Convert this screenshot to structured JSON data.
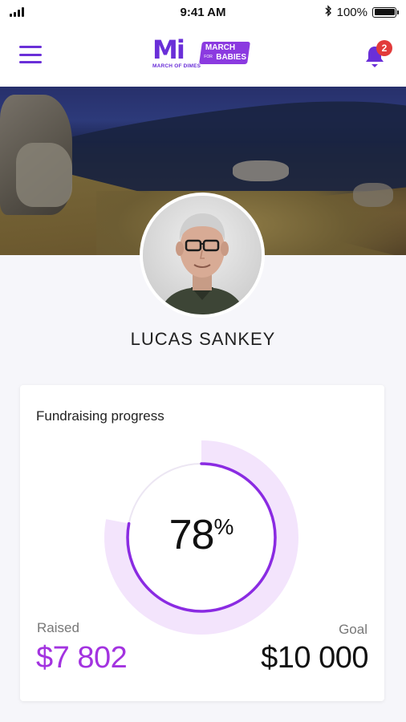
{
  "status_bar": {
    "time": "9:41 AM",
    "battery_percent": "100%",
    "battery_level": 1.0
  },
  "header": {
    "logo_primary": "Mi",
    "logo_primary_caption": "MARCH OF DIMES",
    "logo_secondary_top": "MARCH",
    "logo_secondary_middle": "FOR",
    "logo_secondary_bottom": "BABIES",
    "notification_count": "2",
    "accent_color": "#6a2fd8",
    "badge_color": "#e23b3b"
  },
  "profile": {
    "name": "LUCAS SANKEY"
  },
  "fundraising": {
    "title": "Fundraising progress",
    "percent_value": "78",
    "percent_sign": "%",
    "progress_fraction": 0.78,
    "raised_label": "Raised",
    "raised_value": "$7 802",
    "goal_label": "Goal",
    "goal_value": "$10 000",
    "raised_color": "#a333e0",
    "ring_color": "#8a2be2",
    "ring_track_color": "#f3e4fc"
  },
  "icons": {
    "menu": "hamburger-menu-icon",
    "bell": "bell-icon",
    "bluetooth": "bluetooth-icon",
    "signal": "signal-icon",
    "battery": "battery-icon"
  }
}
